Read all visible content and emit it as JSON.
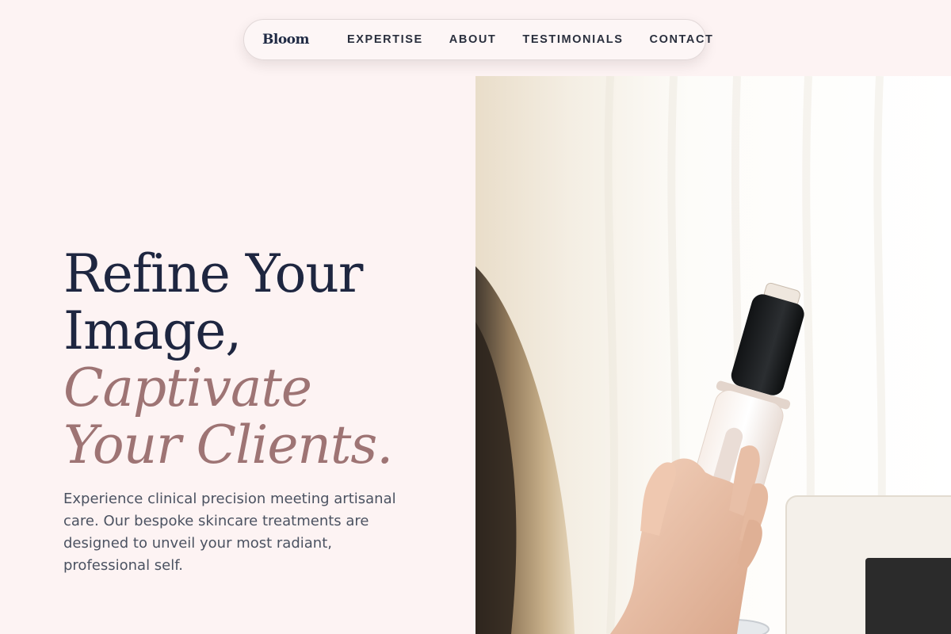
{
  "nav": {
    "brand": "Bloom",
    "links": [
      "EXPERTISE",
      "ABOUT",
      "TESTIMONIALS",
      "CONTACT"
    ]
  },
  "hero": {
    "headline_lines": [
      "Refine Your",
      "Image,"
    ],
    "accent_lines": [
      "Captivate",
      "Your Clients."
    ],
    "subtitle": "Experience clinical precision meeting artisanal care. Our bespoke skincare treatments are designed to unveil your most radiant, professional self.",
    "image_alt": "Hand holding a skincare treatment device"
  },
  "colors": {
    "background": "#fdf3f3",
    "headline": "#1e2640",
    "accent": "#9e7474",
    "body_text": "#4b5261"
  }
}
